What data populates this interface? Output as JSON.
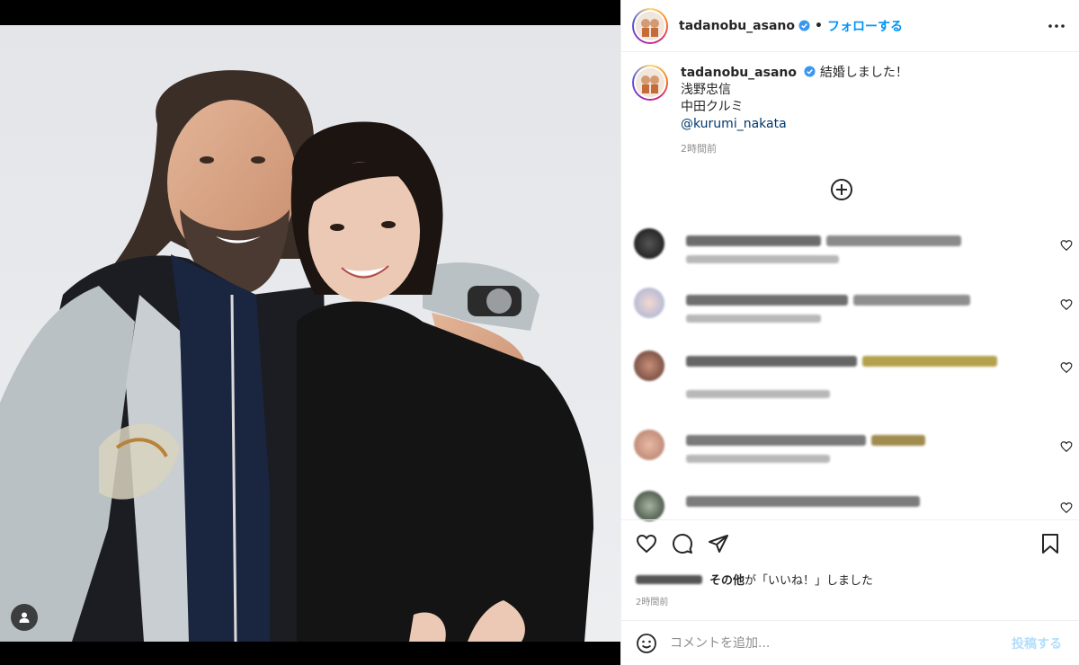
{
  "header": {
    "username": "tadanobu_asano",
    "separator": "•",
    "follow_label": "フォローする"
  },
  "caption": {
    "username": "tadanobu_asano",
    "line1": "結婚しました！",
    "line2": "浅野忠信",
    "line3": "中田クルミ",
    "mention": "@kurumi_nakata",
    "time": "2時間前"
  },
  "likes": {
    "others": "その他",
    "suffix": "が「いいね！」しました"
  },
  "post_time": "2時間前",
  "comment_input": {
    "placeholder": "コメントを追加..."
  },
  "post_button": "投稿する",
  "icons": {
    "header_more": "more-horizontal-icon",
    "load_more": "plus-circle-icon",
    "like": "heart-icon",
    "comment": "comment-bubble-icon",
    "share": "paper-plane-icon",
    "save": "bookmark-icon",
    "emoji": "emoji-icon",
    "tag": "user-tag-icon",
    "verified": "verified-badge-icon"
  },
  "colors": {
    "link_blue": "#0095f6",
    "post_disabled": "#b2dffc",
    "verified_blue": "#3897f0"
  }
}
